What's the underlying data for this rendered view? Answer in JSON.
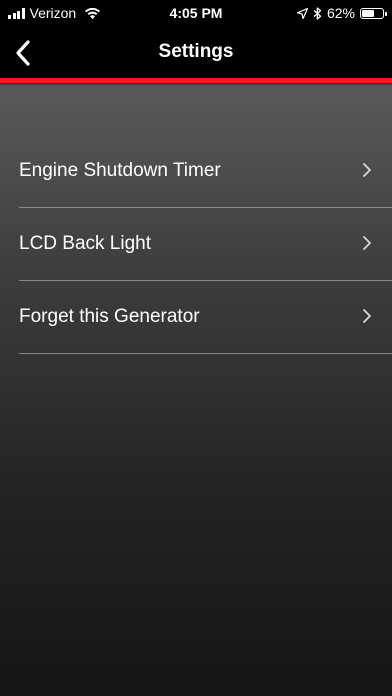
{
  "status_bar": {
    "carrier": "Verizon",
    "time": "4:05 PM",
    "battery_percent": "62%",
    "battery_level": 0.62,
    "icons": [
      "signal-icon",
      "wifi-icon",
      "location-icon",
      "bluetooth-icon",
      "battery-icon"
    ]
  },
  "nav": {
    "title": "Settings",
    "back_icon": "chevron-left-icon"
  },
  "colors": {
    "accent": "#e8201c",
    "background_top": "#5a5a5a",
    "background_bottom": "#151515"
  },
  "settings": {
    "items": [
      {
        "label": "Engine Shutdown Timer",
        "icon": "chevron-right-icon"
      },
      {
        "label": "LCD Back Light",
        "icon": "chevron-right-icon"
      },
      {
        "label": "Forget this Generator",
        "icon": "chevron-right-icon"
      }
    ]
  }
}
